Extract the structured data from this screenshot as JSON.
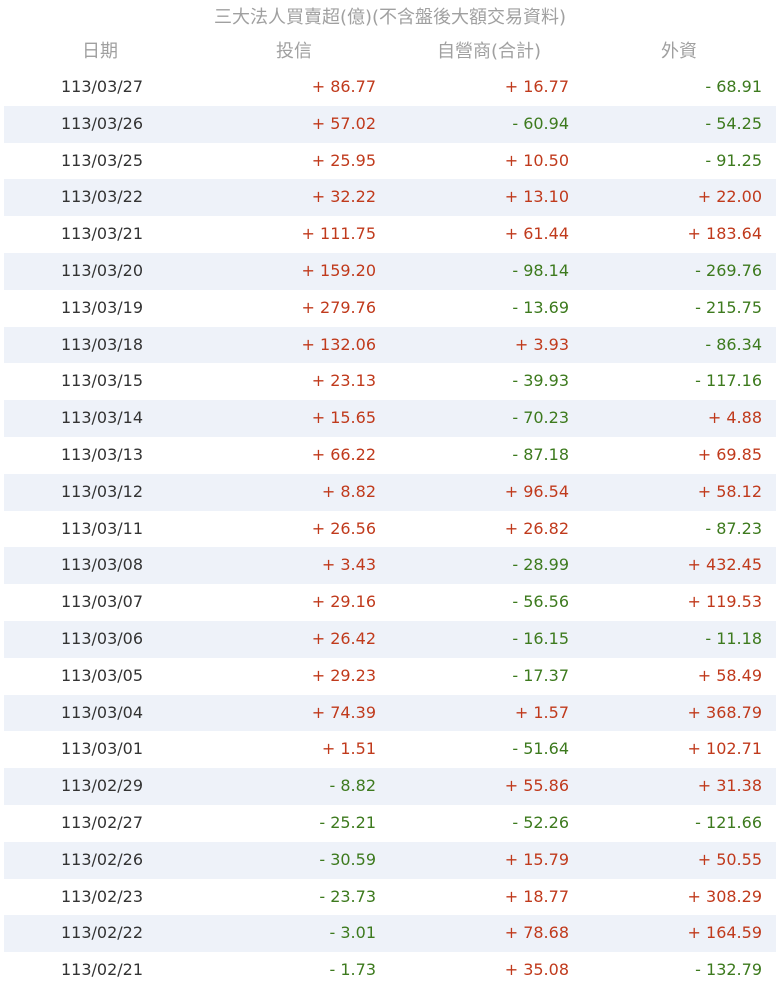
{
  "title": "三大法人買賣超(億)(不含盤後大額交易資料)",
  "headers": {
    "date": "日期",
    "investment_trust": "投信",
    "dealers": "自營商(合計)",
    "foreign": "外資"
  },
  "colors": {
    "positive": "#c03a1c",
    "negative": "#3d7a1e",
    "alt_row": "#eef2f9",
    "header_text": "#a0a0a0"
  },
  "rows": [
    {
      "date": "113/03/27",
      "investment_trust": "+ 86.77",
      "dealers": "+ 16.77",
      "foreign": "- 68.91"
    },
    {
      "date": "113/03/26",
      "investment_trust": "+ 57.02",
      "dealers": "- 60.94",
      "foreign": "- 54.25"
    },
    {
      "date": "113/03/25",
      "investment_trust": "+ 25.95",
      "dealers": "+ 10.50",
      "foreign": "- 91.25"
    },
    {
      "date": "113/03/22",
      "investment_trust": "+ 32.22",
      "dealers": "+ 13.10",
      "foreign": "+ 22.00"
    },
    {
      "date": "113/03/21",
      "investment_trust": "+ 111.75",
      "dealers": "+ 61.44",
      "foreign": "+ 183.64"
    },
    {
      "date": "113/03/20",
      "investment_trust": "+ 159.20",
      "dealers": "- 98.14",
      "foreign": "- 269.76"
    },
    {
      "date": "113/03/19",
      "investment_trust": "+ 279.76",
      "dealers": "- 13.69",
      "foreign": "- 215.75"
    },
    {
      "date": "113/03/18",
      "investment_trust": "+ 132.06",
      "dealers": "+ 3.93",
      "foreign": "- 86.34"
    },
    {
      "date": "113/03/15",
      "investment_trust": "+ 23.13",
      "dealers": "- 39.93",
      "foreign": "- 117.16"
    },
    {
      "date": "113/03/14",
      "investment_trust": "+ 15.65",
      "dealers": "- 70.23",
      "foreign": "+ 4.88"
    },
    {
      "date": "113/03/13",
      "investment_trust": "+ 66.22",
      "dealers": "- 87.18",
      "foreign": "+ 69.85"
    },
    {
      "date": "113/03/12",
      "investment_trust": "+ 8.82",
      "dealers": "+ 96.54",
      "foreign": "+ 58.12"
    },
    {
      "date": "113/03/11",
      "investment_trust": "+ 26.56",
      "dealers": "+ 26.82",
      "foreign": "- 87.23"
    },
    {
      "date": "113/03/08",
      "investment_trust": "+ 3.43",
      "dealers": "- 28.99",
      "foreign": "+ 432.45"
    },
    {
      "date": "113/03/07",
      "investment_trust": "+ 29.16",
      "dealers": "- 56.56",
      "foreign": "+ 119.53"
    },
    {
      "date": "113/03/06",
      "investment_trust": "+ 26.42",
      "dealers": "- 16.15",
      "foreign": "- 11.18"
    },
    {
      "date": "113/03/05",
      "investment_trust": "+ 29.23",
      "dealers": "- 17.37",
      "foreign": "+ 58.49"
    },
    {
      "date": "113/03/04",
      "investment_trust": "+ 74.39",
      "dealers": "+ 1.57",
      "foreign": "+ 368.79"
    },
    {
      "date": "113/03/01",
      "investment_trust": "+ 1.51",
      "dealers": "- 51.64",
      "foreign": "+ 102.71"
    },
    {
      "date": "113/02/29",
      "investment_trust": "- 8.82",
      "dealers": "+ 55.86",
      "foreign": "+ 31.38"
    },
    {
      "date": "113/02/27",
      "investment_trust": "- 25.21",
      "dealers": "- 52.26",
      "foreign": "- 121.66"
    },
    {
      "date": "113/02/26",
      "investment_trust": "- 30.59",
      "dealers": "+ 15.79",
      "foreign": "+ 50.55"
    },
    {
      "date": "113/02/23",
      "investment_trust": "- 23.73",
      "dealers": "+ 18.77",
      "foreign": "+ 308.29"
    },
    {
      "date": "113/02/22",
      "investment_trust": "- 3.01",
      "dealers": "+ 78.68",
      "foreign": "+ 164.59"
    },
    {
      "date": "113/02/21",
      "investment_trust": "- 1.73",
      "dealers": "+ 35.08",
      "foreign": "- 132.79"
    }
  ]
}
